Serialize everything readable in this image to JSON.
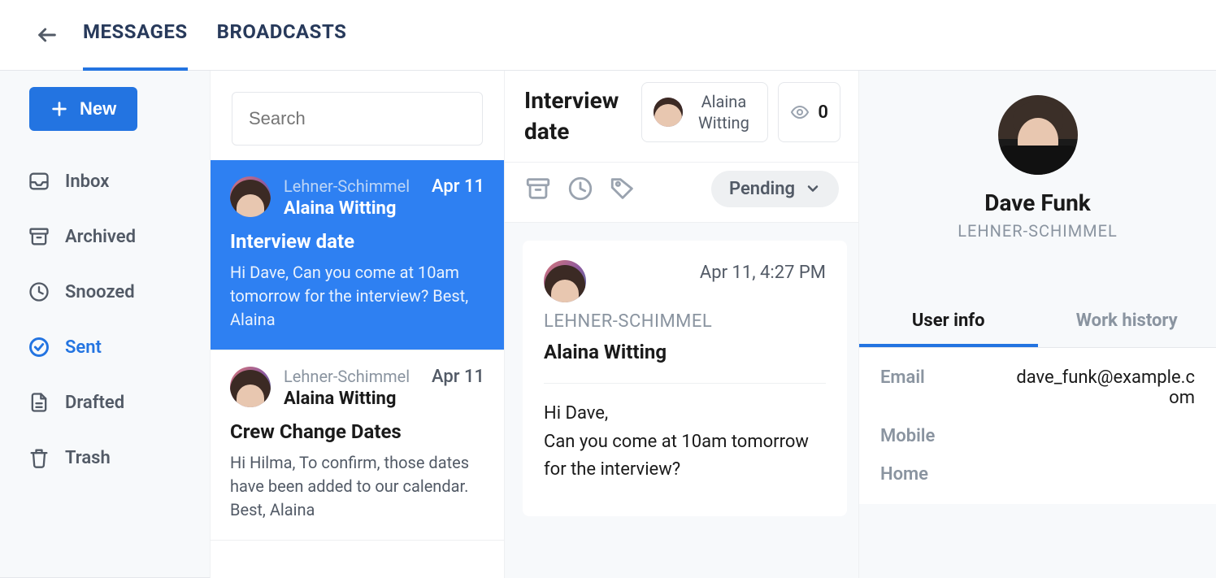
{
  "top": {
    "tabs": [
      "MESSAGES",
      "BROADCASTS"
    ],
    "active_tab": 0
  },
  "sidebar": {
    "new_label": "New",
    "items": [
      {
        "label": "Inbox",
        "icon": "inbox-icon",
        "active": false
      },
      {
        "label": "Archived",
        "icon": "archive-icon",
        "active": false
      },
      {
        "label": "Snoozed",
        "icon": "clock-icon",
        "active": false
      },
      {
        "label": "Sent",
        "icon": "check-circle-icon",
        "active": true
      },
      {
        "label": "Drafted",
        "icon": "document-icon",
        "active": false
      },
      {
        "label": "Trash",
        "icon": "trash-icon",
        "active": false
      }
    ]
  },
  "search": {
    "placeholder": "Search"
  },
  "messages": [
    {
      "company": "Lehner-Schimmel",
      "sender": "Alaina Witting",
      "date": "Apr 11",
      "subject": "Interview date",
      "preview": "Hi Dave, Can you come at 10am tomorrow for the interview? Best, Alaina",
      "active": true
    },
    {
      "company": "Lehner-Schimmel",
      "sender": "Alaina Witting",
      "date": "Apr 11",
      "subject": "Crew Change Dates",
      "preview": "Hi Hilma, To confirm, those dates have been added to our calendar. Best, Alaina",
      "active": false
    }
  ],
  "thread": {
    "title": "Interview date",
    "participant": "Alaina Witting",
    "view_count": "0",
    "status": "Pending",
    "message": {
      "company_upper": "LEHNER-SCHIMMEL",
      "sender": "Alaina Witting",
      "timestamp": "Apr 11, 4:27 PM",
      "body": "Hi Dave,\nCan you come at 10am tomorrow for the interview?"
    }
  },
  "profile": {
    "name": "Dave Funk",
    "company_upper": "LEHNER-SCHIMMEL",
    "tabs": [
      "User info",
      "Work history"
    ],
    "active_tab": 0,
    "fields": {
      "email_label": "Email",
      "email_value": "dave_funk@example.com",
      "mobile_label": "Mobile",
      "home_label": "Home"
    }
  }
}
